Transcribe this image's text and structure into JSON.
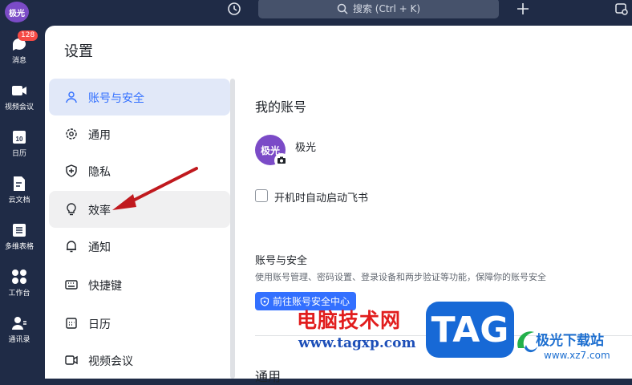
{
  "topbar": {
    "avatar_text": "极光",
    "search_label": "搜索 (Ctrl + K)"
  },
  "rail": {
    "badge": "128",
    "items": [
      "消息",
      "视频会议",
      "日历",
      "云文档",
      "多维表格",
      "工作台",
      "通讯录"
    ],
    "calendar_day": "10"
  },
  "settings": {
    "title": "设置",
    "nav": [
      "账号与安全",
      "通用",
      "隐私",
      "效率",
      "通知",
      "快捷键",
      "日历",
      "视频会议"
    ]
  },
  "account": {
    "section_title": "我的账号",
    "avatar_text": "极光",
    "name": "极光",
    "autostart_label": "开机时自动启动飞书",
    "security_title": "账号与安全",
    "security_desc": "使用账号管理、密码设置、登录设备和两步验证等功能，保障你的账号安全",
    "security_button": "前往账号安全中心",
    "general_title": "通用"
  },
  "watermark": {
    "cn": "电脑技术网",
    "url": "www.tagxp.com",
    "tag": "TAG",
    "site_name": "极光下载站",
    "site_url": "www.xz7.com"
  },
  "colors": {
    "accent": "#3370ff",
    "avatar": "#7b4bc7",
    "arrow": "#c0191e",
    "rail_bg": "#1f2b46"
  }
}
